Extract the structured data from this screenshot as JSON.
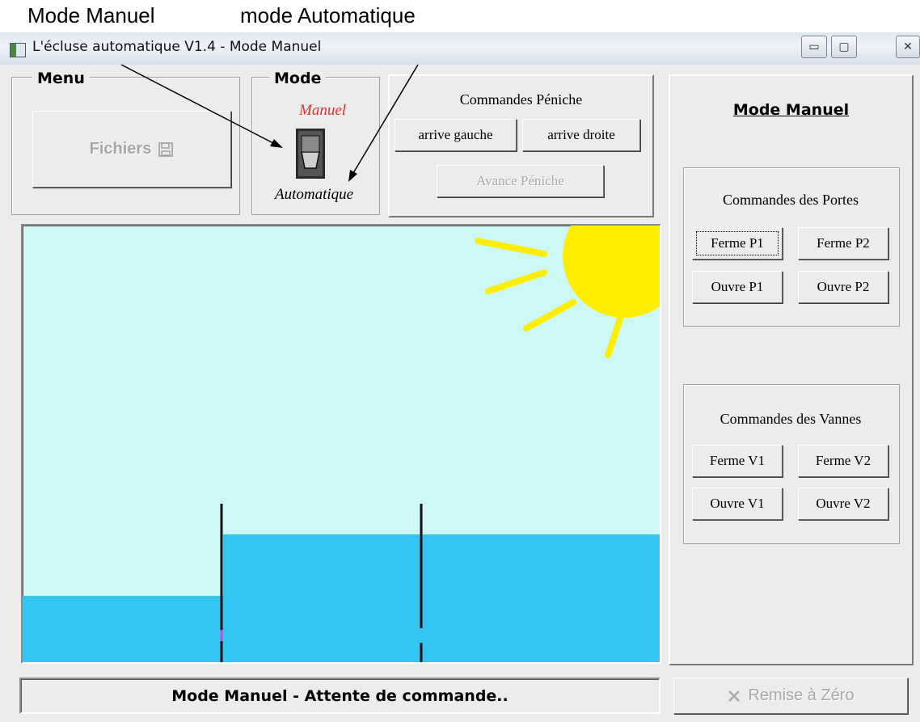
{
  "annotations": {
    "manual": "Mode Manuel",
    "automatic": "mode Automatique"
  },
  "window": {
    "title": "L'écluse automatique V1.4 - Mode Manuel",
    "controls": [
      "▭",
      "▢",
      "✕"
    ]
  },
  "menu": {
    "title": "Menu",
    "files_button": "Fichiers",
    "files_icon": "floppy-disk-icon"
  },
  "mode": {
    "title": "Mode",
    "manual_label": "Manuel",
    "automatic_label": "Automatique",
    "manual_color": "#e0302a"
  },
  "peniche": {
    "title": "Commandes Péniche",
    "left": "arrive gauche",
    "right": "arrive droite",
    "advance": "Avance Péniche"
  },
  "right_panel": {
    "title": "Mode Manuel",
    "portes": {
      "title": "Commandes des Portes",
      "buttons": [
        "Ferme P1",
        "Ferme P2",
        "Ouvre P1",
        "Ouvre P2"
      ]
    },
    "vannes": {
      "title": "Commandes des Vannes",
      "buttons": [
        "Ferme V1",
        "Ferme V2",
        "Ouvre V1",
        "Ouvre V2"
      ]
    }
  },
  "status": {
    "text": "Mode Manuel - Attente de commande.."
  },
  "reset": {
    "label": "Remise à Zéro",
    "icon": "x-mark-icon"
  },
  "colors": {
    "sky": "#ccf8f8",
    "water": "#33c6f0",
    "sun": "#ffee00",
    "gate": "#111111"
  }
}
